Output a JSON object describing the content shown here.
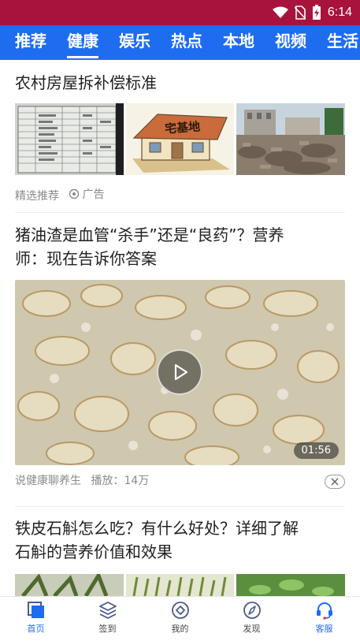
{
  "status": {
    "time": "6:14"
  },
  "tabs": [
    {
      "label": "推荐"
    },
    {
      "label": "健康"
    },
    {
      "label": "娱乐"
    },
    {
      "label": "热点"
    },
    {
      "label": "本地"
    },
    {
      "label": "视频"
    },
    {
      "label": "生活"
    }
  ],
  "active_tab": "健康",
  "articles": [
    {
      "title": "农村房屋拆补偿标准",
      "thumb_text": "宅基地",
      "source": "精选推荐",
      "ad_label": "广告"
    },
    {
      "title_line1": "猪油渣是血管“杀手”还是“良药”？营养",
      "title_line2": "师：现在告诉你答案",
      "duration": "01:56",
      "source": "说健康聊养生",
      "plays": "播放：14万"
    },
    {
      "title_line1": "铁皮石斛怎么吃？有什么好处？详细了解",
      "title_line2": "石斛的营养价值和效果"
    }
  ],
  "bottom_nav": [
    {
      "label": "首页",
      "icon": "home-icon"
    },
    {
      "label": "签到",
      "icon": "layers-icon"
    },
    {
      "label": "我的",
      "icon": "diamond-icon"
    },
    {
      "label": "发现",
      "icon": "compass-icon"
    },
    {
      "label": "客服",
      "icon": "headset-icon"
    }
  ],
  "colors": {
    "status_bar": "#a8133b",
    "tab_bar": "#1e6cf0",
    "active_nav": "#1e6cf0"
  }
}
